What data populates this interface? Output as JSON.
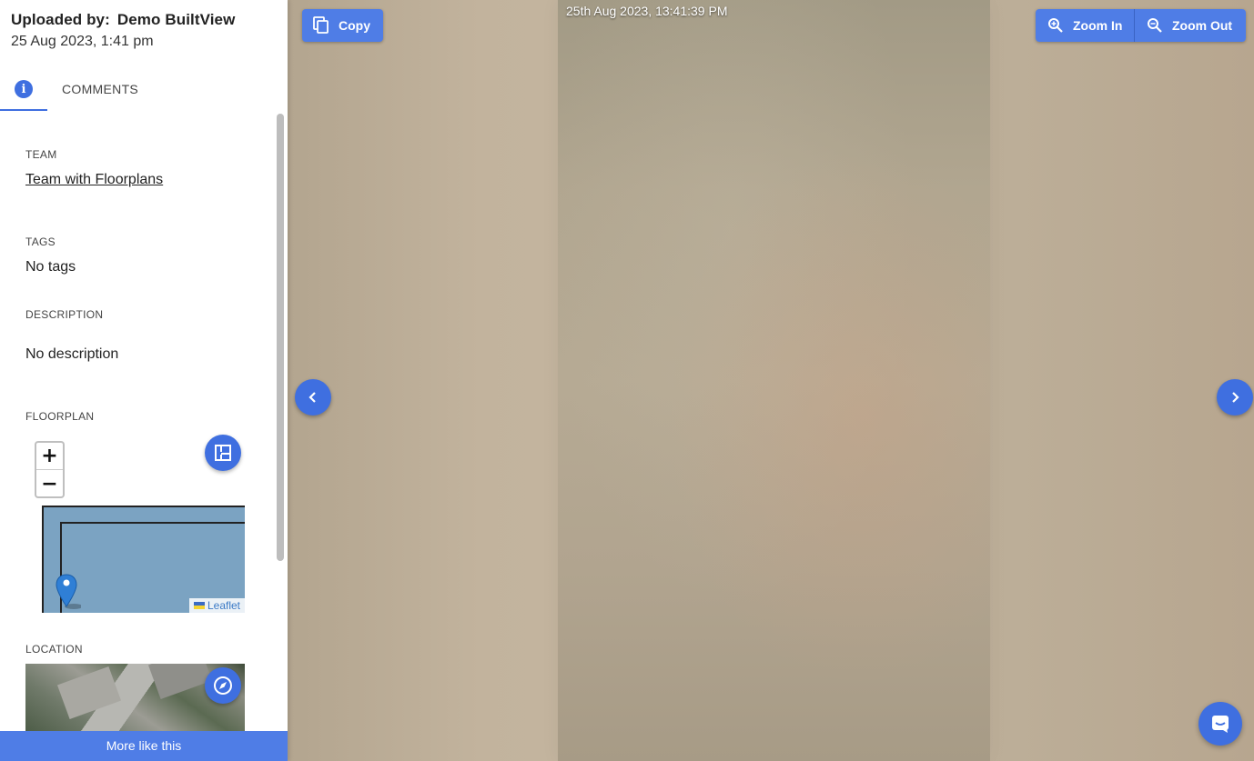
{
  "header": {
    "uploaded_by_label": "Uploaded by:",
    "uploaded_by_name": "Demo BuiltView",
    "upload_date": "25 Aug 2023, 1:41 pm"
  },
  "tabs": {
    "info_icon": "info-icon",
    "comments_label": "COMMENTS"
  },
  "details": {
    "team_label": "TEAM",
    "team_value": "Team with Floorplans",
    "tags_label": "TAGS",
    "tags_value": "No tags",
    "description_label": "DESCRIPTION",
    "description_value": "No description",
    "floorplan_label": "FLOORPLAN",
    "location_label": "LOCATION"
  },
  "floorplan_map": {
    "zoom_in": "+",
    "zoom_out": "−",
    "attribution": "Leaflet"
  },
  "footer": {
    "more_like_this": "More like this"
  },
  "viewer": {
    "timestamp": "25th Aug 2023, 13:41:39 PM",
    "copy_label": "Copy",
    "zoom_in_label": "Zoom In",
    "zoom_out_label": "Zoom Out"
  },
  "colors": {
    "accent": "#4f7de6",
    "accent_dark": "#3f6fe0"
  }
}
